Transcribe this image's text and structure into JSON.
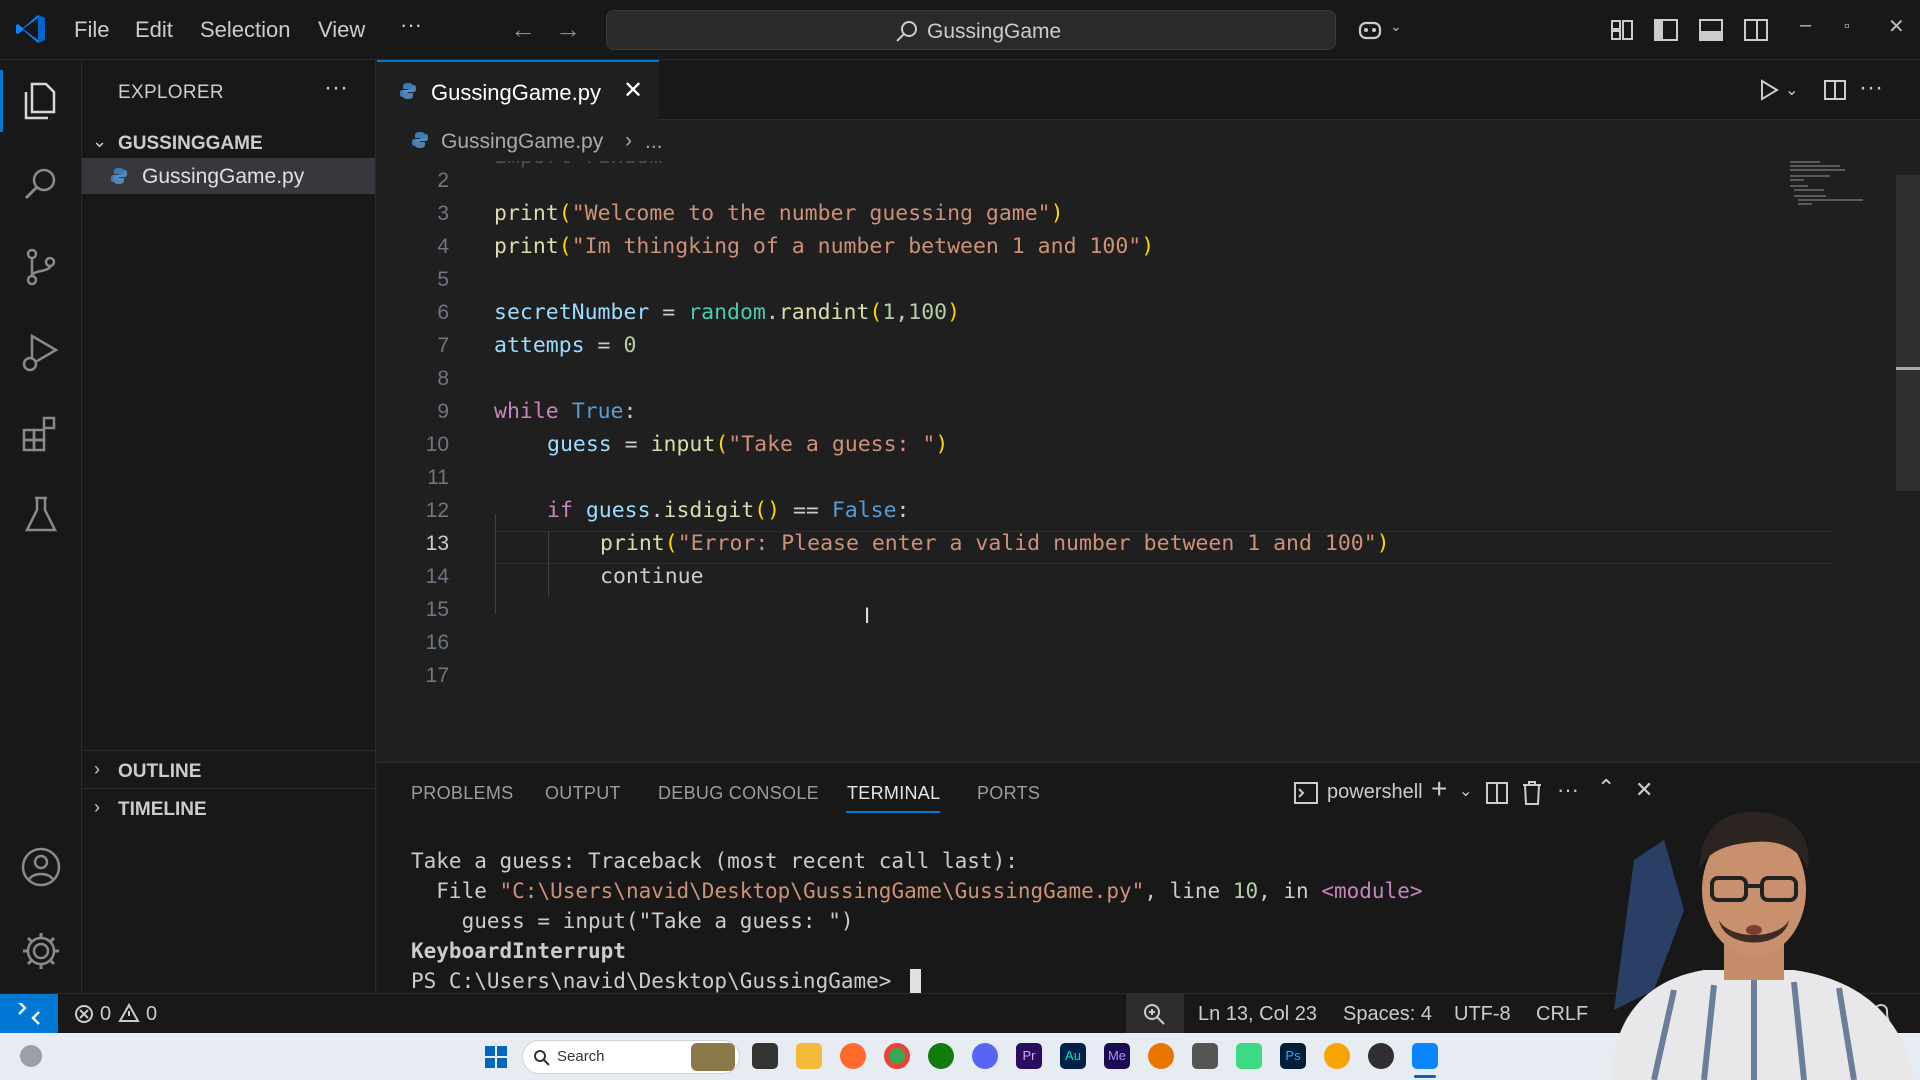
{
  "titlebar": {
    "menu": [
      "File",
      "Edit",
      "Selection",
      "View",
      "···"
    ],
    "search_text": "GussingGame"
  },
  "sidebar": {
    "header": "EXPLORER",
    "folder": "GUSSINGGAME",
    "file": "GussingGame.py",
    "outline": "OUTLINE",
    "timeline": "TIMELINE"
  },
  "tab": {
    "label": "GussingGame.py",
    "close": "✕"
  },
  "breadcrumb": {
    "file": "GussingGame.py",
    "sep": "›",
    "more": "..."
  },
  "editor": {
    "line_numbers": [
      "2",
      "3",
      "4",
      "5",
      "6",
      "7",
      "8",
      "9",
      "10",
      "11",
      "12",
      "13",
      "14",
      "15",
      "16",
      "17"
    ],
    "active_line": "13",
    "lines": {
      "l1": "import random",
      "l3": [
        "print",
        "(",
        "\"Welcome to the number guessing game\"",
        ")"
      ],
      "l4": [
        "print",
        "(",
        "\"Im thingking of a number between 1 and 100\"",
        ")"
      ],
      "l6": [
        "secretNumber",
        " = ",
        "random",
        ".",
        "randint",
        "(",
        "1",
        ",",
        "100",
        ")"
      ],
      "l7": [
        "attemps",
        " = ",
        "0"
      ],
      "l9": [
        "while",
        " ",
        "True",
        ":"
      ],
      "l10": [
        "guess",
        " = ",
        "input",
        "(",
        "\"Take a guess: \"",
        ")"
      ],
      "l12": [
        "if",
        " ",
        "guess",
        ".",
        "isdigit",
        "()",
        " == ",
        "False",
        ":"
      ],
      "l13": [
        "print",
        "(",
        "\"Error: Please enter a valid number between 1 and 100\"",
        ")"
      ],
      "l14": "continue"
    }
  },
  "panel": {
    "tabs": [
      "PROBLEMS",
      "OUTPUT",
      "DEBUG CONSOLE",
      "TERMINAL",
      "PORTS"
    ],
    "active_tab": "TERMINAL",
    "shell": "powershell",
    "terminal": {
      "t1": "Take a guess: Traceback (most recent call last):",
      "t2_a": "  File ",
      "t2_b": "\"C:\\Users\\navid\\Desktop\\GussingGame\\GussingGame.py\"",
      "t2_c": ", line ",
      "t2_d": "10",
      "t2_e": ", in ",
      "t2_f": "<module>",
      "t3": "    guess = input(\"Take a guess: \")",
      "t4": "KeyboardInterrupt",
      "t5": "PS C:\\Users\\navid\\Desktop\\GussingGame> "
    }
  },
  "statusbar": {
    "errors": "0",
    "warnings": "0",
    "position": "Ln 13, Col 23",
    "spaces": "Spaces: 4",
    "encoding": "UTF-8",
    "eol": "CRLF"
  },
  "taskbar": {
    "search_text": "Search",
    "apps": [
      "start",
      "search",
      "files",
      "explorer",
      "firefox",
      "chrome",
      "xbox",
      "discord",
      "premiere",
      "audition",
      "media-encoder",
      "blender",
      "calendar",
      "android",
      "photoshop",
      "app-orange",
      "obs",
      "vscode"
    ]
  },
  "colors": {
    "accent": "#0078d4",
    "background": "#1f1f1f",
    "sidebar": "#181818",
    "keyword": "#c586c0",
    "function": "#dcdcaa",
    "string": "#ce9178",
    "variable": "#9cdcfe",
    "class": "#4ec9b0",
    "number": "#b5cea8",
    "constant": "#569cd6",
    "error_text": "#e256b0"
  }
}
